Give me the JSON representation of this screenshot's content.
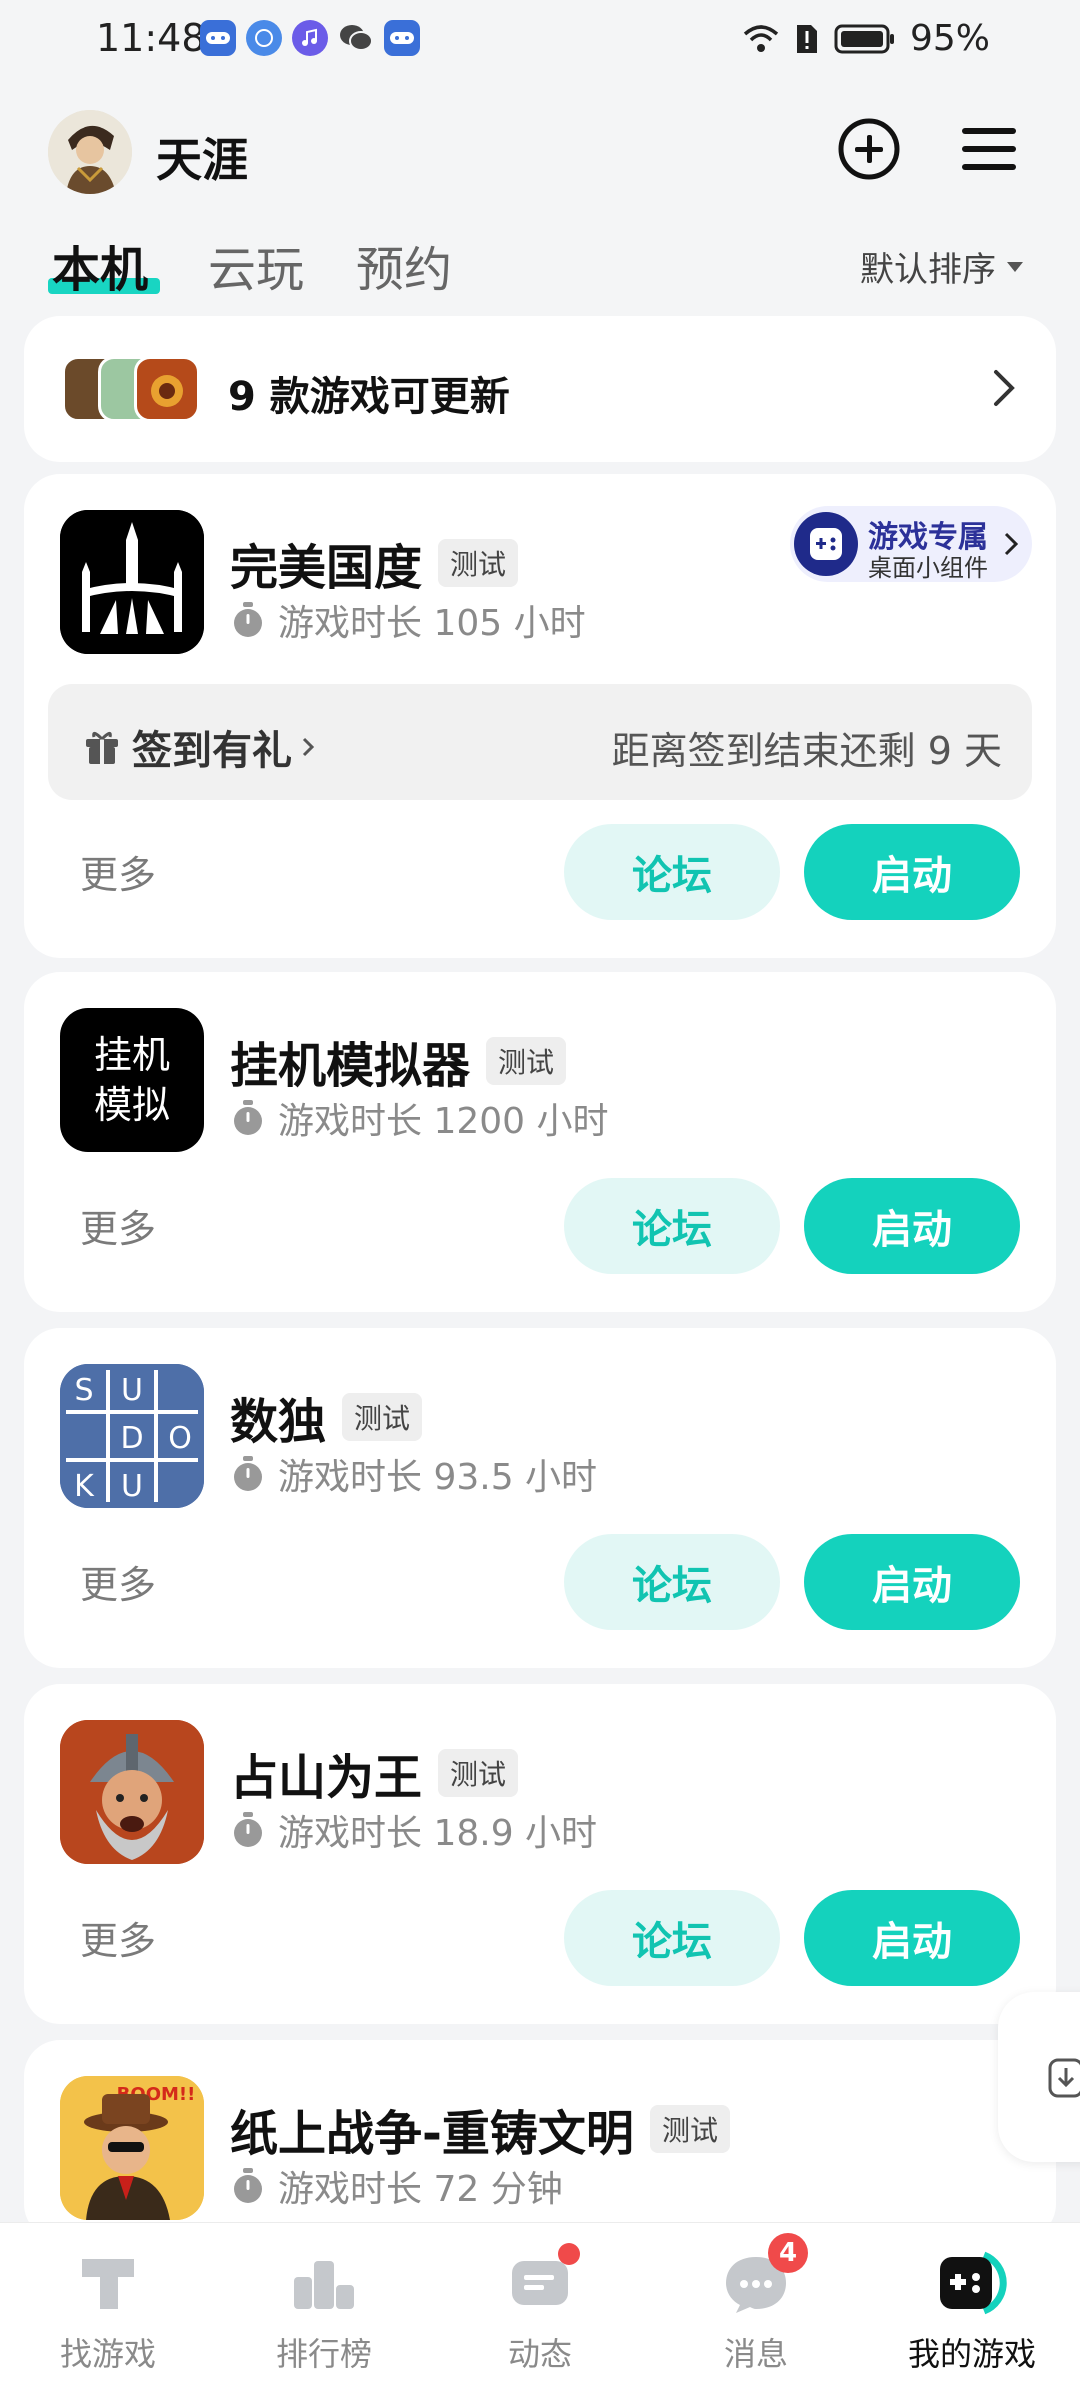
{
  "status_bar": {
    "time": "11:48",
    "battery": "95%"
  },
  "header": {
    "username": "天涯"
  },
  "tabs": [
    {
      "label": "本机"
    },
    {
      "label": "云玩"
    },
    {
      "label": "预约"
    }
  ],
  "sort": {
    "label": "默认排序"
  },
  "updates": {
    "text": "9 款游戏可更新"
  },
  "common": {
    "more": "更多",
    "forum": "论坛",
    "launch": "启动",
    "badge": "测试"
  },
  "games": [
    {
      "title": "完美国度",
      "playtime": "游戏时长 105 小时"
    },
    {
      "title": "挂机模拟器",
      "playtime": "游戏时长 1200 小时",
      "icon_text_line1": "挂机",
      "icon_text_line2": "模拟"
    },
    {
      "title": "数独",
      "playtime": "游戏时长 93.5 小时",
      "icon_letters": [
        "S",
        "U",
        "D",
        "O",
        "K",
        "U"
      ]
    },
    {
      "title": "占山为王",
      "playtime": "游戏时长 18.9 小时"
    },
    {
      "title": "纸上战争-重铸文明",
      "playtime": "游戏时长 72 分钟",
      "icon_text": "BOOM!!"
    }
  ],
  "widget": {
    "title": "游戏专属",
    "subtitle": "桌面小组件"
  },
  "signin": {
    "label": "签到有礼",
    "remaining": "距离签到结束还剩 9 天"
  },
  "bottom_nav": [
    {
      "label": "找游戏",
      "icon": "find-game-icon"
    },
    {
      "label": "排行榜",
      "icon": "ranking-icon"
    },
    {
      "label": "动态",
      "icon": "feed-icon"
    },
    {
      "label": "消息",
      "icon": "message-icon",
      "badge": "4"
    },
    {
      "label": "我的游戏",
      "icon": "my-games-icon"
    }
  ],
  "colors": {
    "accent": "#14d2bd",
    "accent_light": "#e2f7f5",
    "badge_red": "#f04a4a"
  }
}
